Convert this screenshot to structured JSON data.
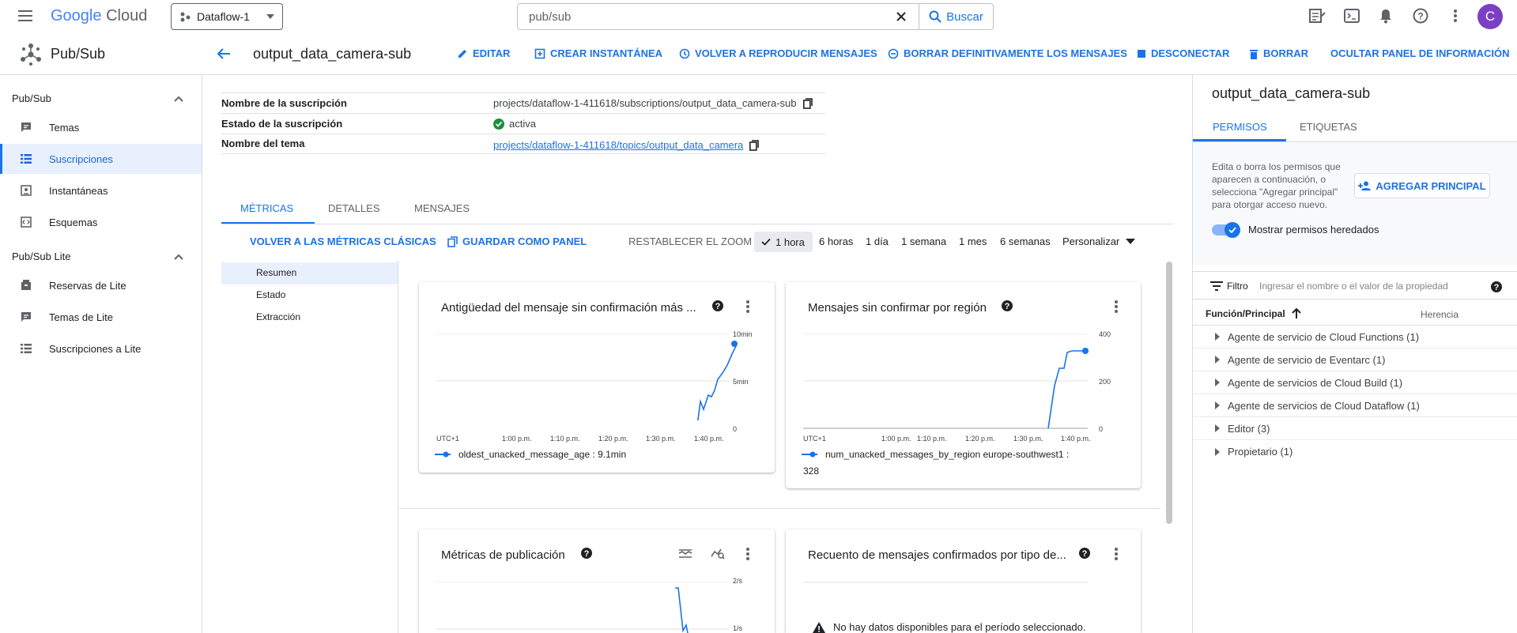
{
  "topbar": {
    "logo_google": "Google",
    "logo_cloud": "Cloud",
    "project": "Dataflow-1",
    "search_value": "pub/sub",
    "search_button": "Buscar",
    "avatar_letter": "C"
  },
  "product": {
    "name": "Pub/Sub"
  },
  "header": {
    "title": "output_data_camera-sub",
    "actions": {
      "edit": "EDITAR",
      "snapshot": "CREAR INSTANTÁNEA",
      "replay": "VOLVER A REPRODUCIR MENSAJES",
      "purge": "BORRAR DEFINITIVAMENTE LOS MENSAJES",
      "detach": "DESCONECTAR",
      "delete": "BORRAR",
      "hide_panel": "OCULTAR PANEL DE INFORMACIÓN"
    }
  },
  "sidebar": {
    "section1": "Pub/Sub",
    "items1": [
      "Temas",
      "Suscripciones",
      "Instantáneas",
      "Esquemas"
    ],
    "section2": "Pub/Sub Lite",
    "items2": [
      "Reservas de Lite",
      "Temas de Lite",
      "Suscripciones a Lite"
    ]
  },
  "details": {
    "sub_name_label": "Nombre de la suscripción",
    "sub_name_value": "projects/dataflow-1-411618/subscriptions/output_data_camera-sub",
    "state_label": "Estado de la suscripción",
    "state_value": "activa",
    "topic_label": "Nombre del tema",
    "topic_value": "projects/dataflow-1-411618/topics/output_data_camera"
  },
  "tabs": [
    "MÉTRICAS",
    "DETALLES",
    "MENSAJES"
  ],
  "metrics_toolbar": {
    "classic": "VOLVER A LAS MÉTRICAS CLÁSICAS",
    "save_panel": "GUARDAR COMO PANEL",
    "reset_zoom": "RESTABLECER EL ZOOM",
    "ranges": [
      "1 hora",
      "6 horas",
      "1 día",
      "1 semana",
      "1 mes",
      "6 semanas"
    ],
    "custom": "Personalizar"
  },
  "metric_nav": [
    "Resumen",
    "Estado",
    "Extracción"
  ],
  "cards": {
    "c1": {
      "title": "Antigüedad del mensaje sin confirmación más ...",
      "y_ticks": [
        "10min",
        "5min",
        "0"
      ],
      "x_ticks": [
        "UTC+1",
        "1:00 p.m.",
        "1:10 p.m.",
        "1:20 p.m.",
        "1:30 p.m.",
        "1:40 p.m."
      ],
      "legend": "oldest_unacked_message_age :  9.1min"
    },
    "c2": {
      "title": "Mensajes sin confirmar por región",
      "y_ticks": [
        "400",
        "200",
        "0"
      ],
      "x_ticks": [
        "UTC+1",
        "1:00 p.m.",
        "1:10 p.m.",
        "1:20 p.m.",
        "1:30 p.m.",
        "1:40 p.m."
      ],
      "legend_line1": "num_unacked_messages_by_region europe-southwest1 :",
      "legend_line2": "328"
    },
    "c3": {
      "title": "Métricas de publicación",
      "y_ticks": [
        "2/s",
        "1/s"
      ]
    },
    "c4": {
      "title": "Recuento de mensajes confirmados por tipo de...",
      "empty": "No hay datos disponibles para el período seleccionado."
    }
  },
  "chart_data": [
    {
      "type": "line",
      "title": "Antigüedad del mensaje sin confirmación más ...",
      "x": [
        "1:00 p.m.",
        "1:10 p.m.",
        "1:20 p.m.",
        "1:30 p.m.",
        "1:40 p.m."
      ],
      "ylabel": "",
      "ylim": [
        0,
        10
      ],
      "series": [
        {
          "name": "oldest_unacked_message_age",
          "last_value": 9.1
        }
      ]
    },
    {
      "type": "line",
      "title": "Mensajes sin confirmar por región",
      "x": [
        "1:00 p.m.",
        "1:10 p.m.",
        "1:20 p.m.",
        "1:30 p.m.",
        "1:40 p.m."
      ],
      "ylim": [
        0,
        400
      ],
      "series": [
        {
          "name": "num_unacked_messages_by_region europe-southwest1",
          "last_value": 328
        }
      ]
    }
  ],
  "right_panel": {
    "title": "output_data_camera-sub",
    "tabs": [
      "PERMISOS",
      "ETIQUETAS"
    ],
    "description": "Edita o borra los permisos que aparecen a continuación, o selecciona \"Agregar principal\" para otorgar acceso nuevo.",
    "add_principal": "AGREGAR PRINCIPAL",
    "inherited_toggle": "Mostrar permisos heredados",
    "filter_label": "Filtro",
    "filter_placeholder": "Ingresar el nombre o el valor de la propiedad",
    "col_role": "Función/Principal",
    "col_inherit": "Herencia",
    "roles": [
      "Agente de servicio de Cloud Functions (1)",
      "Agente de servicio de Eventarc (1)",
      "Agente de servicios de Cloud Build (1)",
      "Agente de servicios de Cloud Dataflow (1)",
      "Editor (3)",
      "Propietario (1)"
    ]
  },
  "colors": {
    "accent": "#1a73e8",
    "line": "#1a73e8",
    "active_bg": "#e8f0fe",
    "success": "#1e8e3e"
  }
}
